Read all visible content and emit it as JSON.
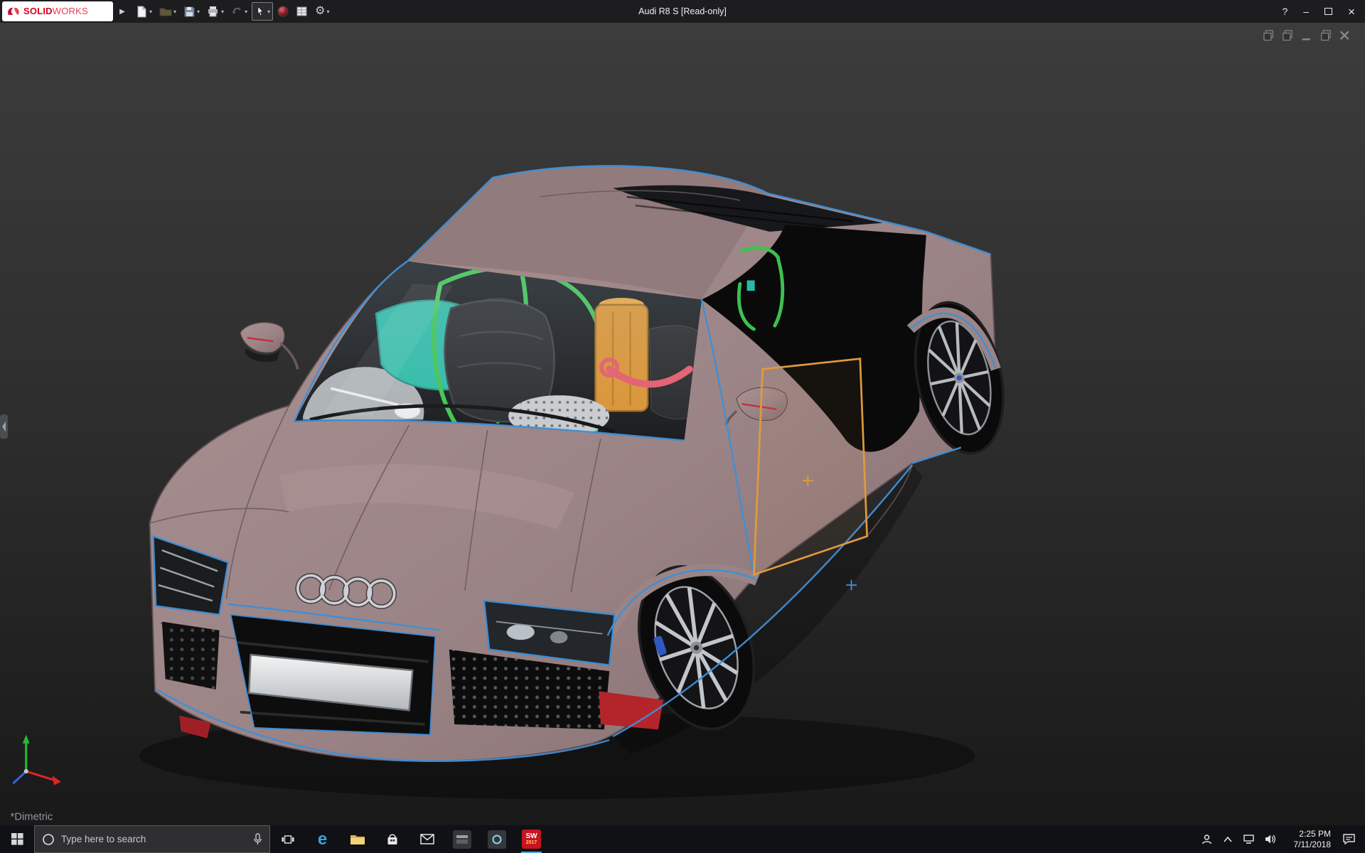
{
  "colors": {
    "accent-blue": "#3f8fd6",
    "sel-orange": "#e09a3c",
    "body": "#9b8486",
    "titlebar-bg": "#1d1d1f",
    "taskbar-bg": "#101114"
  },
  "titlebar": {
    "brand_solid": "SOLID",
    "brand_works": "WORKS",
    "flyout_glyph": "▶",
    "title": "Audi R8 S [Read-only]",
    "help_glyph": "?",
    "minimize_glyph": "–",
    "close_glyph": "×",
    "caret_glyph": "▾"
  },
  "toolbar": {
    "icons": [
      {
        "name": "new-document"
      },
      {
        "name": "open"
      },
      {
        "name": "save"
      },
      {
        "name": "print"
      },
      {
        "name": "undo"
      },
      {
        "name": "select-cursor",
        "state": "active"
      },
      {
        "name": "appearance-sphere"
      },
      {
        "name": "design-table"
      },
      {
        "name": "options-gear"
      }
    ],
    "gear_glyph": "⚙"
  },
  "viewport": {
    "model_name": "Audi R8 S",
    "orientation_label": "*Dimetric",
    "selection": "door-panel",
    "document_controls": [
      "restore",
      "restore",
      "minimize",
      "restore",
      "close"
    ]
  },
  "taskbar": {
    "search_placeholder": "Type here to search",
    "edge_glyph": "e",
    "solidworks": {
      "label": "SW",
      "year": "2017"
    },
    "clock": {
      "time": "2:25 PM",
      "date": "7/11/2018"
    }
  }
}
